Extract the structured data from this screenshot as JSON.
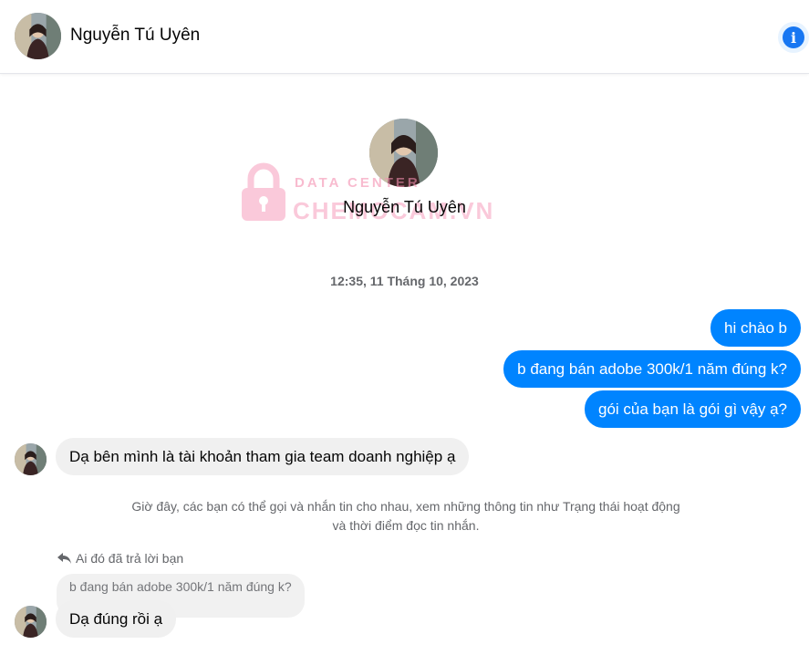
{
  "header": {
    "name": "Nguyễn Tú Uyên",
    "info_icon": "info-icon"
  },
  "profile": {
    "name": "Nguyễn Tú Uyên"
  },
  "watermark": {
    "top": "DATA CENTER",
    "bottom": "CHEMOCAM.VN"
  },
  "timestamp": "12:35, 11 Tháng 10, 2023",
  "messages": {
    "out": [
      "hi chào b",
      "b đang bán adobe 300k/1 năm đúng k?",
      "gói của bạn là gói gì vậy ạ?"
    ],
    "in1": "Dạ bên mình là tài khoản tham gia team doanh nghiệp ạ",
    "system_note": "Giờ đây, các bạn có thể gọi và nhắn tin cho nhau, xem những thông tin như Trạng thái hoạt động và thời điểm đọc tin nhắn.",
    "reply_label": "Ai đó đã trả lời bạn",
    "reply_quote": "b đang bán adobe 300k/1 năm đúng k?",
    "in2": "Dạ đúng rồi ạ"
  },
  "colors": {
    "outgoing_bubble": "#0084ff",
    "incoming_bubble": "#f0f0f0",
    "accent": "#1877f2"
  }
}
